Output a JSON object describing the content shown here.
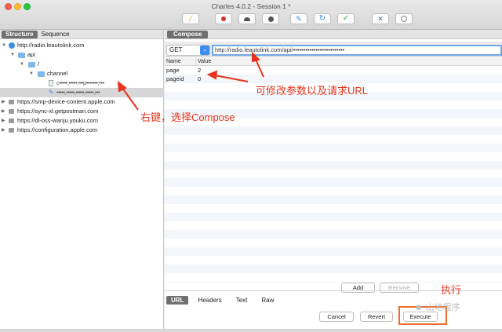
{
  "window": {
    "title": "Charles 4.0.2 - Session 1 *"
  },
  "toolbar": {
    "icons": [
      "broom-icon",
      "record-icon",
      "throttle-icon",
      "breakpoint-icon",
      "compose-pen-icon",
      "repeat-icon",
      "validate-check-icon",
      "tools-icon",
      "settings-globe-icon"
    ]
  },
  "left": {
    "tabs": [
      "Structure",
      "Sequence"
    ],
    "tree": [
      {
        "label": "http://radio.leautolink.com",
        "icon": "globe-icon"
      },
      {
        "label": "api",
        "icon": "folder-icon"
      },
      {
        "label": "/",
        "icon": "folder-icon"
      },
      {
        "label": "channel",
        "icon": "folder-icon"
      },
      {
        "label": "c•••••,•••••,•••p•••••••;•••",
        "icon": "file-icon"
      },
      {
        "label": "•••••,•••••,•••••,•••••,•••",
        "icon": "compose-pen-icon"
      },
      {
        "label": "https://smp-device-content.apple.com",
        "icon": "lock-icon"
      },
      {
        "label": "https://sync-xl.getpostman.com",
        "icon": "lock-icon"
      },
      {
        "label": "https://dl-oss-wanju.youku.com",
        "icon": "lock-icon"
      },
      {
        "label": "https://configuration.apple.com",
        "icon": "lock-icon"
      }
    ]
  },
  "right": {
    "tab": "Compose",
    "method": "GET",
    "url": "http://radio.leautolink.com/api/•••••••••••••••••••••••••",
    "columns": {
      "name": "Name",
      "value": "Value"
    },
    "params": [
      {
        "name": "page",
        "value": "2"
      },
      {
        "name": "pageid",
        "value": "0"
      }
    ],
    "add_label": "Add",
    "remove_label": "Remove",
    "bottom_tabs": [
      "URL",
      "Headers",
      "Text",
      "Raw"
    ],
    "cancel_label": "Cancel",
    "revert_label": "Revert",
    "execute_label": "Execute"
  },
  "annotations": {
    "modify": "可修改参数以及请求URL",
    "right_click": "右键，选择Compose",
    "execute": "执行"
  },
  "watermark": "☻ 山地程序"
}
